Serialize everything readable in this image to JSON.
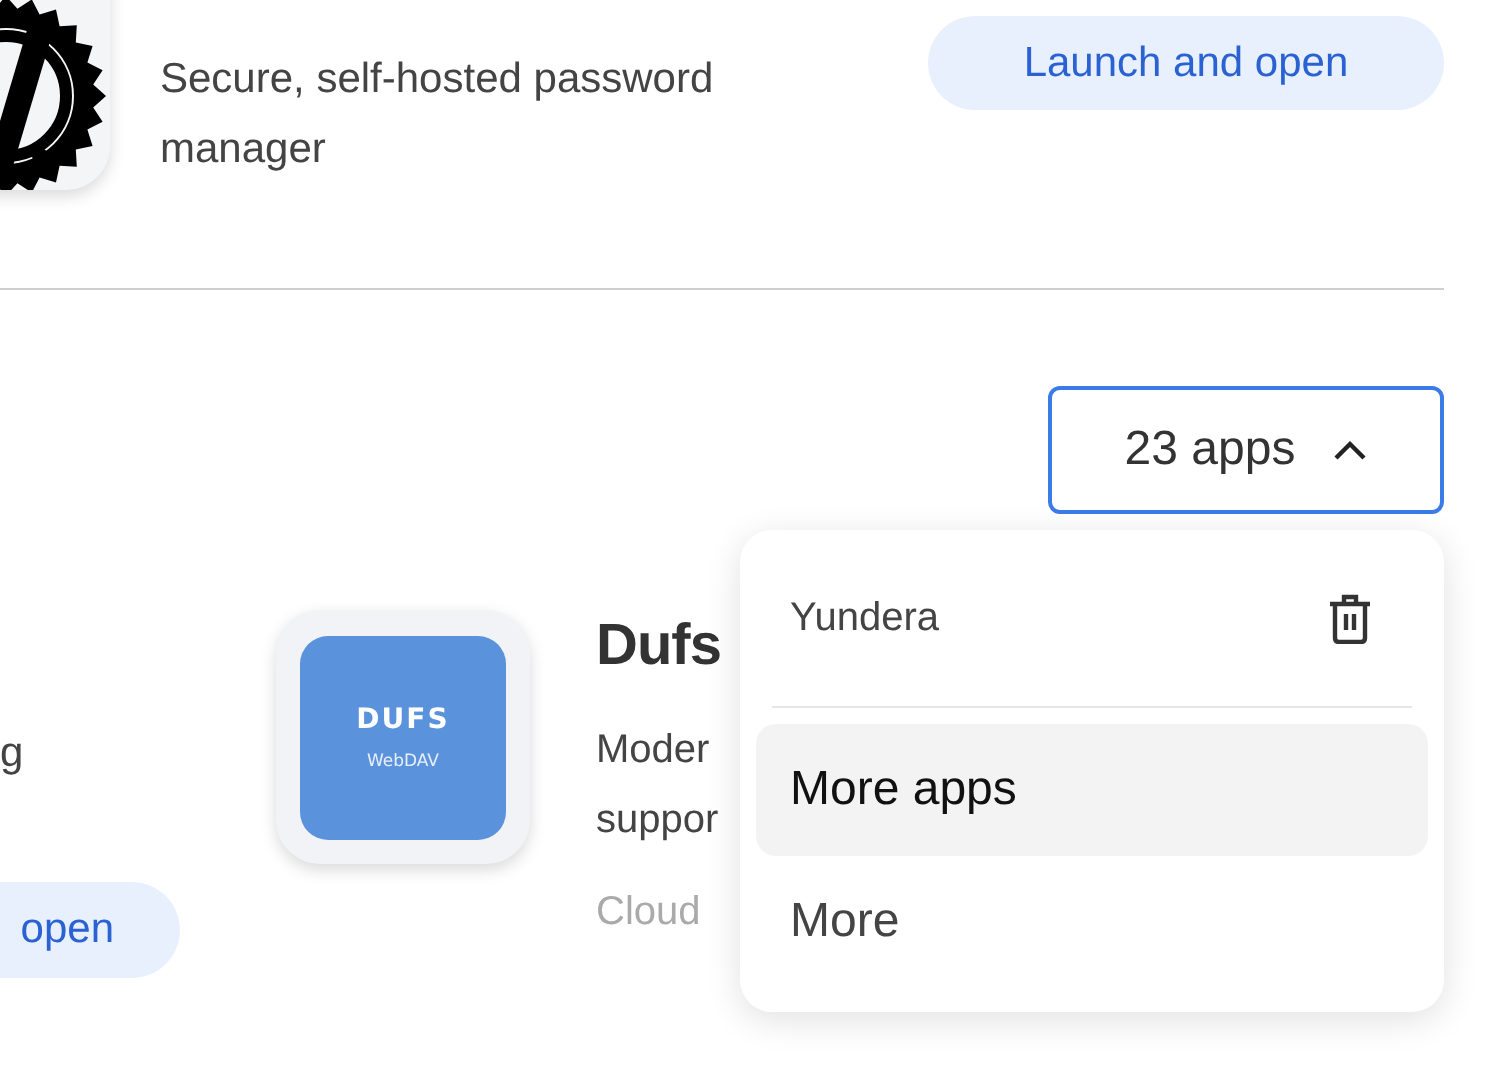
{
  "top_app": {
    "description": "Secure, self-hosted password manager",
    "button": "Launch and open"
  },
  "apps_dropdown": {
    "label": "23 apps",
    "expanded": true
  },
  "left_app": {
    "description": "g",
    "button": "open"
  },
  "app": {
    "icon_title": "DUFS",
    "icon_subtitle": "WebDAV",
    "name": "Dufs",
    "description_lines": [
      "Moder",
      "suppor"
    ],
    "category": "Cloud"
  },
  "menu": {
    "header": "Yundera",
    "items": [
      {
        "label": "More apps",
        "selected": true
      },
      {
        "label": "More",
        "selected": false
      }
    ]
  }
}
